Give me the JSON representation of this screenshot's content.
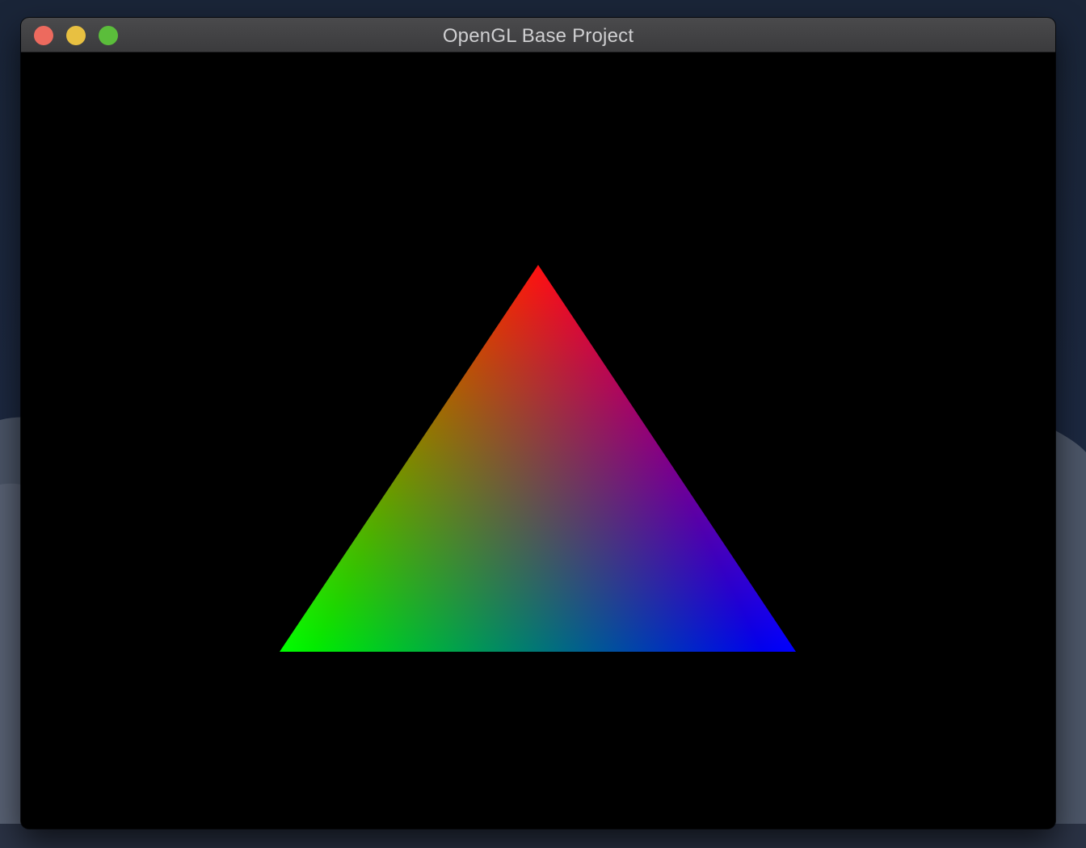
{
  "window": {
    "title": "OpenGL Base Project",
    "controls": {
      "close_color": "#ed6a5e",
      "minimize_color": "#e8c041",
      "zoom_color": "#5bbd3b"
    }
  },
  "viewport": {
    "clear_color": "#000000",
    "triangle": {
      "top_color": "#ff0000",
      "left_color": "#00ff00",
      "right_color": "#0000ff"
    }
  }
}
